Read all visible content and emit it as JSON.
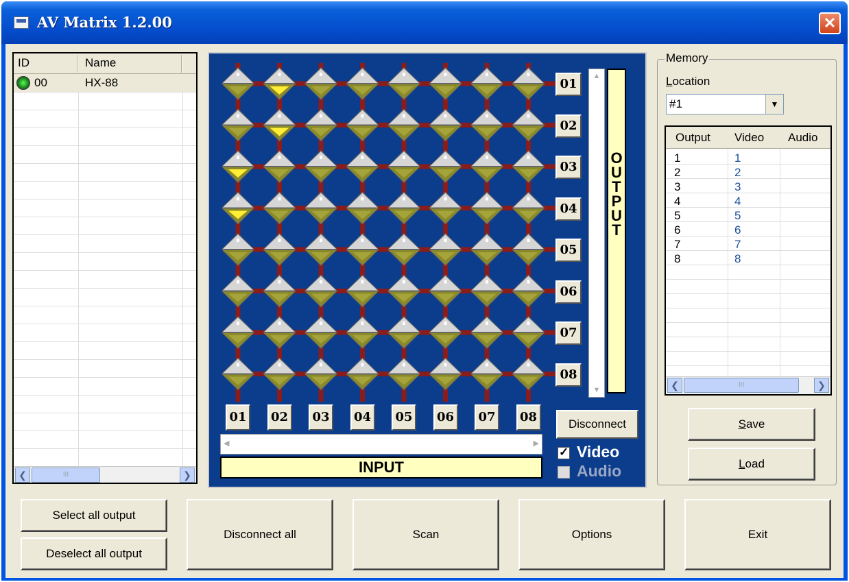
{
  "window": {
    "title": "AV Matrix 1.2.00",
    "close_label": "✕"
  },
  "devices": {
    "headers": [
      "ID",
      "Name"
    ],
    "rows": [
      {
        "id": "00",
        "name": "HX-88",
        "status_color": "#22aa22"
      }
    ],
    "scroll_thumb": "III"
  },
  "matrix": {
    "outputs": [
      "01",
      "02",
      "03",
      "04",
      "05",
      "06",
      "07",
      "08"
    ],
    "inputs": [
      "01",
      "02",
      "03",
      "04",
      "05",
      "06",
      "07",
      "08"
    ],
    "output_label": [
      "O",
      "U",
      "T",
      "P",
      "U",
      "T"
    ],
    "input_label": "INPUT",
    "disconnect_label": "Disconnect",
    "video_label": "Video",
    "audio_label": "Audio",
    "video_checked": true,
    "audio_checked": false,
    "active_points": [
      {
        "input": 2,
        "output": 1
      },
      {
        "input": 2,
        "output": 2
      },
      {
        "input": 1,
        "output": 3
      },
      {
        "input": 1,
        "output": 4
      }
    ],
    "colors": {
      "background": "#0b3d8c",
      "line": "#8b1c1c",
      "node": "#8a8a2a",
      "active": "#ffee33"
    }
  },
  "memory": {
    "group_label": "Memory",
    "location_label": "Location",
    "location_value": "#1",
    "table_headers": [
      "Output",
      "Video",
      "Audio"
    ],
    "rows": [
      {
        "output": "1",
        "video": "1",
        "audio": ""
      },
      {
        "output": "2",
        "video": "2",
        "audio": ""
      },
      {
        "output": "3",
        "video": "3",
        "audio": ""
      },
      {
        "output": "4",
        "video": "4",
        "audio": ""
      },
      {
        "output": "5",
        "video": "5",
        "audio": ""
      },
      {
        "output": "6",
        "video": "6",
        "audio": ""
      },
      {
        "output": "7",
        "video": "7",
        "audio": ""
      },
      {
        "output": "8",
        "video": "8",
        "audio": ""
      }
    ],
    "scroll_thumb": "III",
    "save_label": "Save",
    "load_label": "Load"
  },
  "bottom": {
    "select_all": "Select all output",
    "deselect_all": "Deselect all output",
    "disconnect_all": "Disconnect all",
    "scan": "Scan",
    "options": "Options",
    "exit": "Exit"
  }
}
